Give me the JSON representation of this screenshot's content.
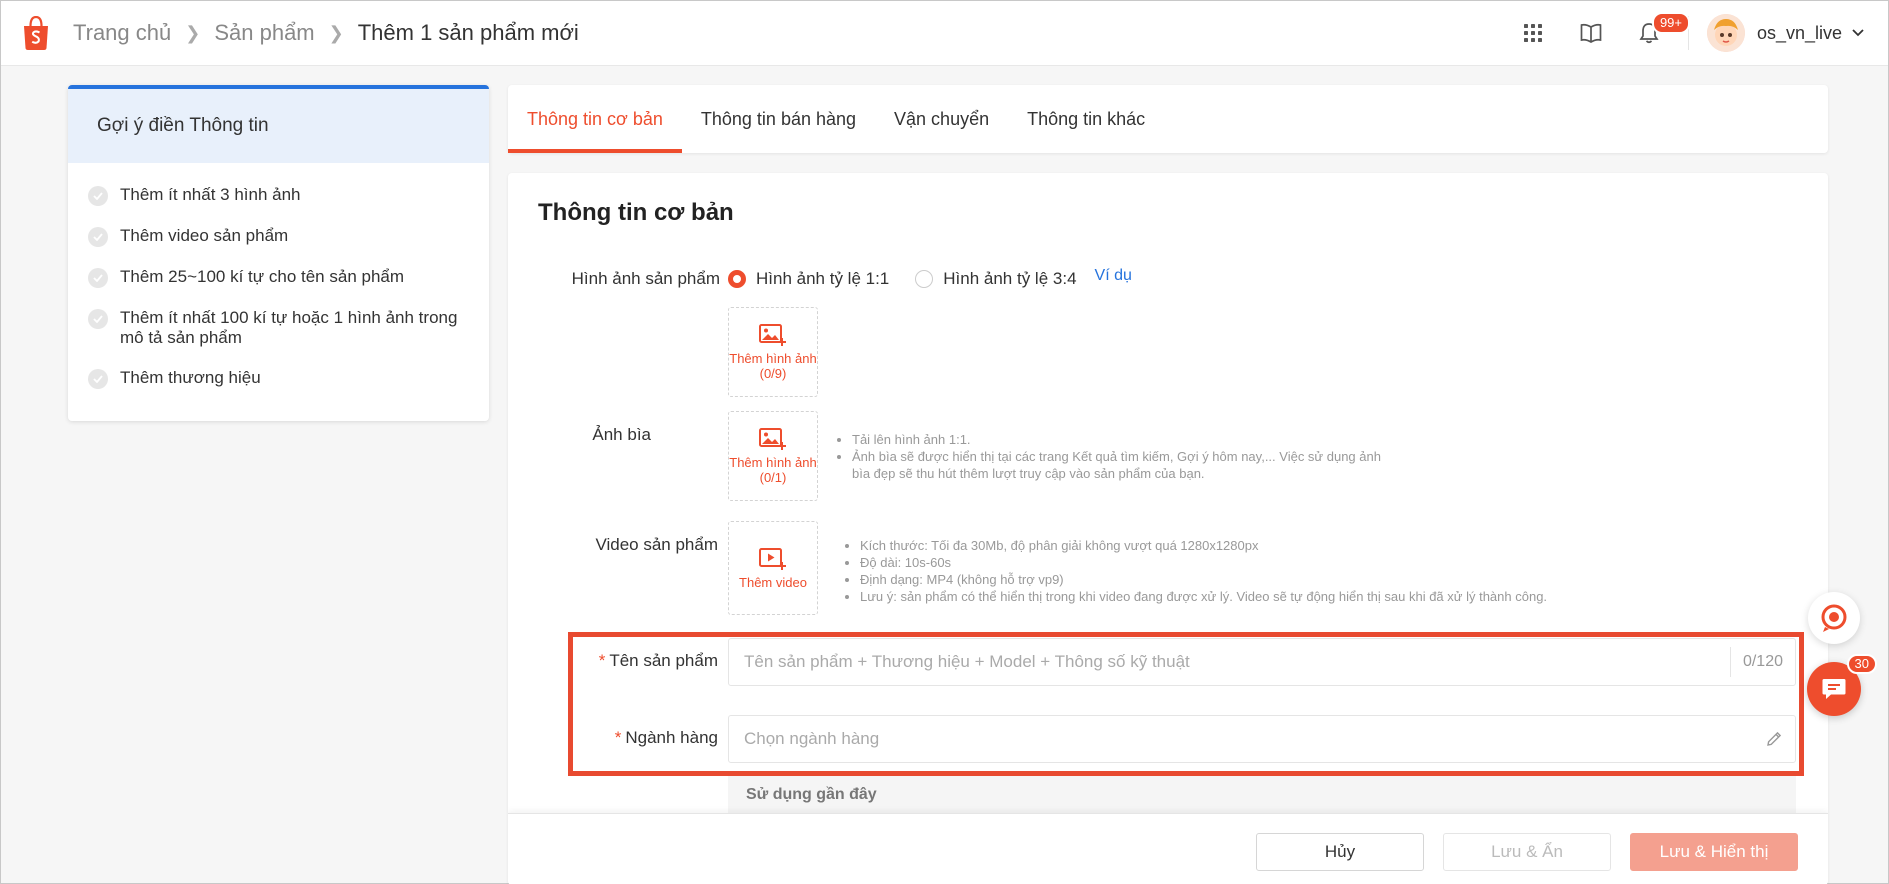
{
  "header": {
    "breadcrumb": [
      "Trang chủ",
      "Sản phẩm",
      "Thêm 1 sản phẩm mới"
    ],
    "notification_count": "99+",
    "username": "os_vn_live",
    "brand_color": "#ee4d2d"
  },
  "tips": {
    "title": "Gợi ý điền Thông tin",
    "items": [
      "Thêm ít nhất 3 hình ảnh",
      "Thêm video sản phẩm",
      "Thêm 25~100 kí tự cho tên sản phẩm",
      "Thêm ít nhất 100 kí tự hoặc 1 hình ảnh trong mô tả sản phẩm",
      "Thêm thương hiệu"
    ]
  },
  "tabs": [
    "Thông tin cơ bản",
    "Thông tin bán hàng",
    "Vận chuyển",
    "Thông tin khác"
  ],
  "form": {
    "section_title": "Thông tin cơ bản",
    "images": {
      "label": "Hình ảnh sản phẩm",
      "ratio_1_1": "Hình ảnh tỷ lệ 1:1",
      "ratio_3_4": "Hình ảnh tỷ lệ 3:4",
      "example": "Ví dụ",
      "upload_label": "Thêm hình ảnh (0/9)"
    },
    "cover": {
      "label": "Ảnh bìa",
      "upload_label": "Thêm hình ảnh (0/1)",
      "hints": [
        "Tải lên hình ảnh 1:1.",
        "Ảnh bìa sẽ được hiển thị tại các trang Kết quả tìm kiếm, Gợi ý hôm nay,... Việc sử dụng ảnh bìa đẹp sẽ thu hút thêm lượt truy cập vào sản phẩm của bạn."
      ]
    },
    "video": {
      "label": "Video sản phẩm",
      "upload_label": "Thêm video",
      "hints": [
        "Kích thước: Tối đa 30Mb, độ phân giải không vượt quá 1280x1280px",
        "Độ dài: 10s-60s",
        "Định dạng: MP4 (không hỗ trợ vp9)",
        "Lưu ý: sản phẩm có thể hiển thị trong khi video đang được xử lý. Video sẽ tự động hiển thị sau khi đã xử lý thành công."
      ]
    },
    "product_name": {
      "label": "Tên sản phẩm",
      "placeholder": "Tên sản phẩm + Thương hiệu + Model + Thông số kỹ thuật",
      "counter": "0/120"
    },
    "category": {
      "label": "Ngành hàng",
      "placeholder": "Chọn ngành hàng",
      "recent_title": "Sử dụng gần đây"
    }
  },
  "footer": {
    "cancel": "Hủy",
    "save_hide": "Lưu & Ẩn",
    "save_show": "Lưu & Hiển thị"
  },
  "chat": {
    "badge": "30"
  }
}
